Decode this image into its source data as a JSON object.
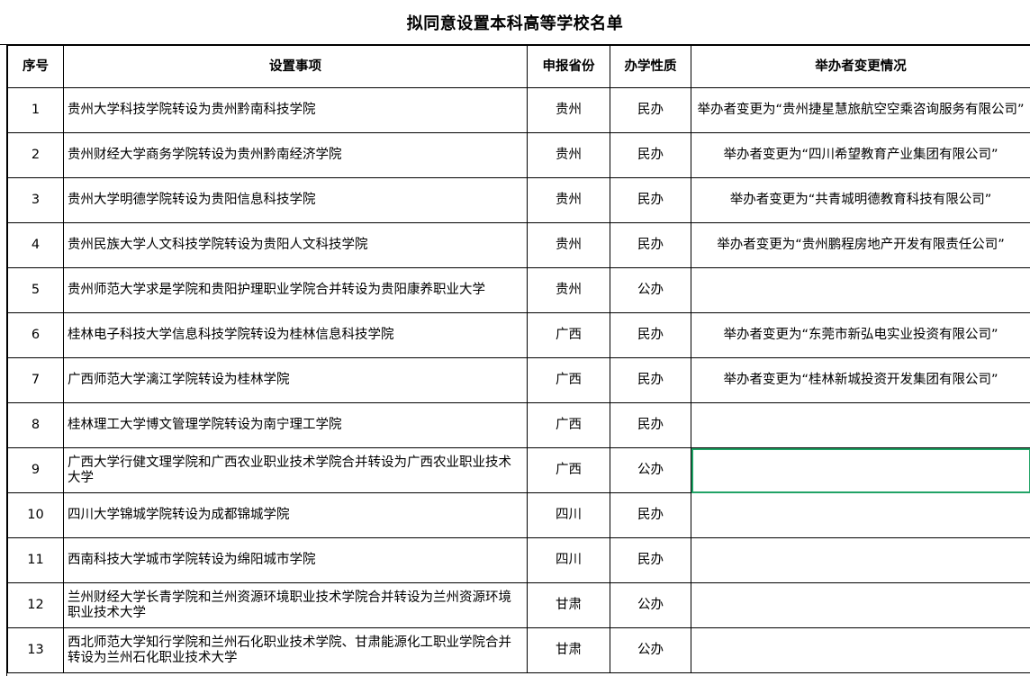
{
  "title": "拟同意设置本科高等学校名单",
  "headers": {
    "num": "序号",
    "item": "设置事项",
    "province": "申报省份",
    "type": "办学性质",
    "change": "举办者变更情况"
  },
  "rows": [
    {
      "num": "1",
      "item": "贵州大学科技学院转设为贵州黔南科技学院",
      "province": "贵州",
      "type": "民办",
      "change": "举办者变更为“贵州捷星慧旅航空空乘咨询服务有限公司”"
    },
    {
      "num": "2",
      "item": "贵州财经大学商务学院转设为贵州黔南经济学院",
      "province": "贵州",
      "type": "民办",
      "change": "举办者变更为“四川希望教育产业集团有限公司”"
    },
    {
      "num": "3",
      "item": "贵州大学明德学院转设为贵阳信息科技学院",
      "province": "贵州",
      "type": "民办",
      "change": "举办者变更为“共青城明德教育科技有限公司”"
    },
    {
      "num": "4",
      "item": "贵州民族大学人文科技学院转设为贵阳人文科技学院",
      "province": "贵州",
      "type": "民办",
      "change": "举办者变更为“贵州鹏程房地产开发有限责任公司”"
    },
    {
      "num": "5",
      "item": "贵州师范大学求是学院和贵阳护理职业学院合并转设为贵阳康养职业大学",
      "province": "贵州",
      "type": "公办",
      "change": ""
    },
    {
      "num": "6",
      "item": "桂林电子科技大学信息科技学院转设为桂林信息科技学院",
      "province": "广西",
      "type": "民办",
      "change": "举办者变更为“东莞市新弘电实业投资有限公司”"
    },
    {
      "num": "7",
      "item": "广西师范大学漓江学院转设为桂林学院",
      "province": "广西",
      "type": "民办",
      "change": "举办者变更为“桂林新城投资开发集团有限公司”"
    },
    {
      "num": "8",
      "item": "桂林理工大学博文管理学院转设为南宁理工学院",
      "province": "广西",
      "type": "民办",
      "change": ""
    },
    {
      "num": "9",
      "item": "广西大学行健文理学院和广西农业职业技术学院合并转设为广西农业职业技术大学",
      "province": "广西",
      "type": "公办",
      "change": ""
    },
    {
      "num": "10",
      "item": "四川大学锦城学院转设为成都锦城学院",
      "province": "四川",
      "type": "民办",
      "change": ""
    },
    {
      "num": "11",
      "item": "西南科技大学城市学院转设为绵阳城市学院",
      "province": "四川",
      "type": "民办",
      "change": ""
    },
    {
      "num": "12",
      "item": "兰州财经大学长青学院和兰州资源环境职业技术学院合并转设为兰州资源环境职业技术大学",
      "province": "甘肃",
      "type": "公办",
      "change": ""
    },
    {
      "num": "13",
      "item": "西北师范大学知行学院和兰州石化职业技术学院、甘肃能源化工职业学院合并转设为兰州石化职业技术大学",
      "province": "甘肃",
      "type": "公办",
      "change": ""
    }
  ],
  "colors": {
    "grid": "#000000",
    "selection": "#21a366"
  }
}
